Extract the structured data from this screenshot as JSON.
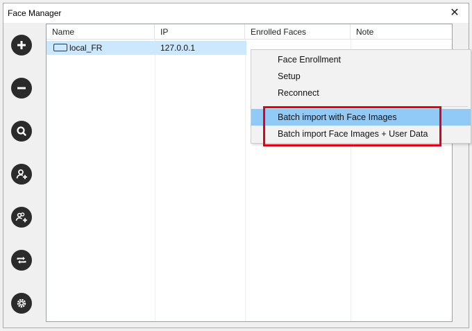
{
  "window": {
    "title": "Face Manager",
    "close_glyph": "✕"
  },
  "toolbar": {
    "buttons": [
      {
        "name": "add-icon"
      },
      {
        "name": "remove-icon"
      },
      {
        "name": "search-icon"
      },
      {
        "name": "add-user-icon"
      },
      {
        "name": "add-group-icon"
      },
      {
        "name": "sync-icon"
      },
      {
        "name": "settings-icon"
      }
    ]
  },
  "list": {
    "columns": [
      "Name",
      "IP",
      "Enrolled Faces",
      "Note"
    ],
    "rows": [
      {
        "name": "local_FR",
        "ip": "127.0.0.1",
        "enrolled_faces": "",
        "note": ""
      }
    ]
  },
  "context_menu": {
    "items": [
      "Face Enrollment",
      "Setup",
      "Reconnect",
      "Batch import with Face Images",
      "Batch import Face Images + User Data"
    ],
    "hovered_index": 3
  },
  "colors": {
    "highlight_border": "#e0001a",
    "selection": "#cce8ff",
    "menu_hover": "#91c9f7",
    "icon": "#2b2b2b"
  }
}
